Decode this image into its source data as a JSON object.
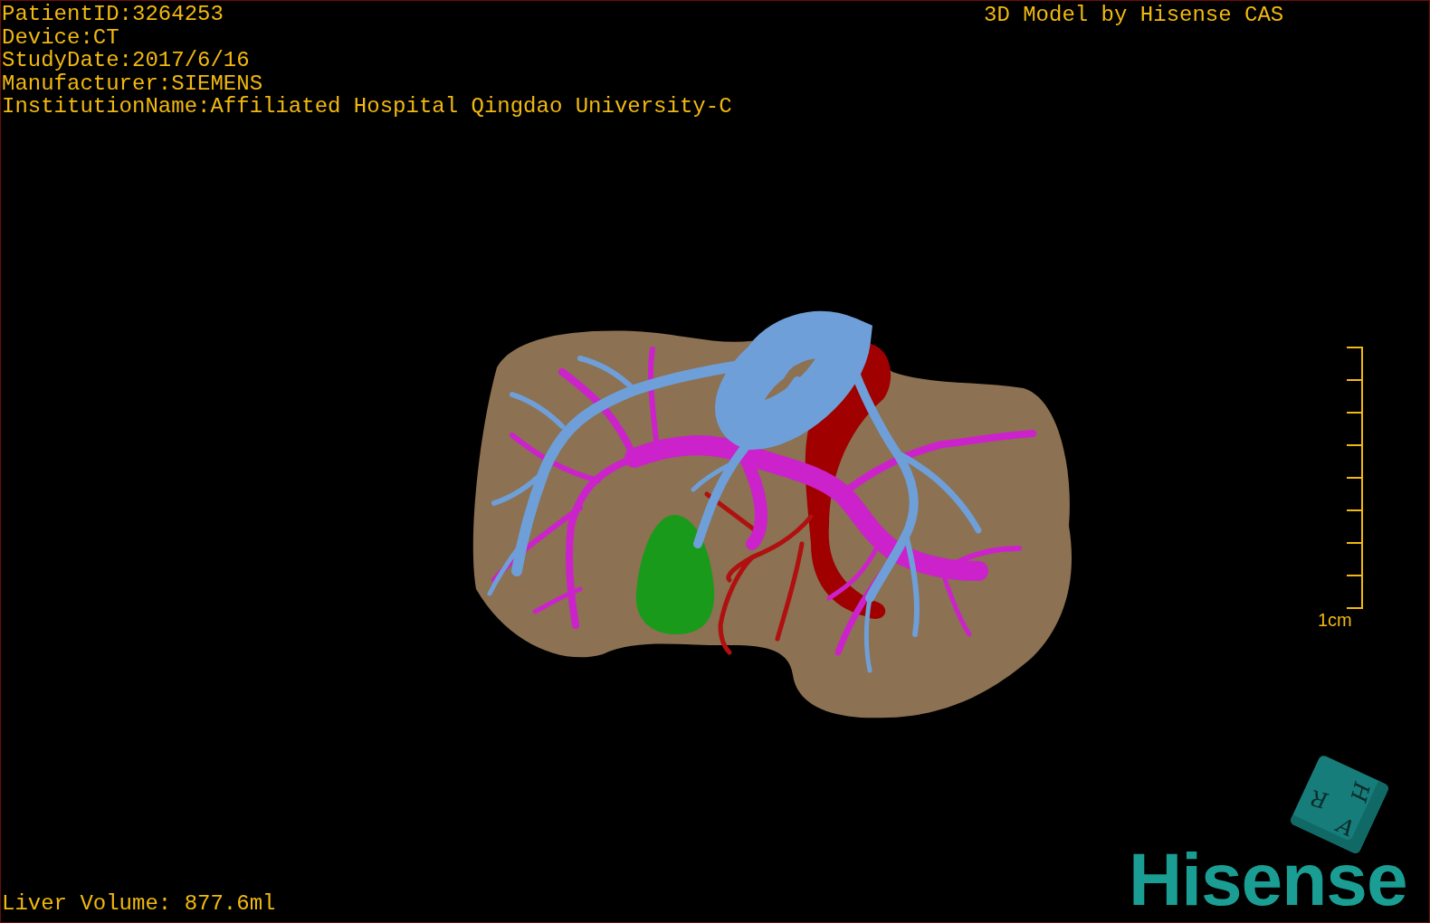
{
  "info_lines": [
    "PatientID:3264253",
    "Device:CT",
    "StudyDate:2017/6/16",
    "Manufacturer:SIEMENS",
    "InstitutionName:Affiliated Hospital Qingdao University-C"
  ],
  "model_credit": "3D Model by Hisense CAS",
  "scale_bar": {
    "label": "1cm"
  },
  "liver_volume": "Liver Volume: 877.6ml",
  "orientation_cube": {
    "faces": [
      "H",
      "R",
      "A"
    ]
  },
  "logo": "Hisense"
}
